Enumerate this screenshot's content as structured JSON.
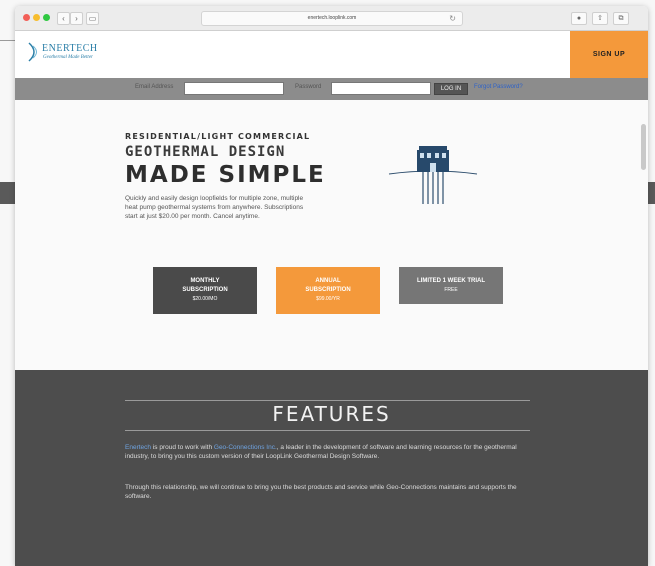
{
  "browser": {
    "url": "enertech.looplink.com",
    "reload_glyph": "↻",
    "back_glyph": "‹",
    "forward_glyph": "›"
  },
  "header": {
    "logo_name": "ENERTECH",
    "logo_tagline": "Geothermal Made Better",
    "signup_label": "SIGN UP"
  },
  "login_bar": {
    "email_label": "Email Address",
    "password_label": "Password",
    "login_label": "LOG IN",
    "forgot_label": "Forgot Password?"
  },
  "hero": {
    "kicker": "RESIDENTIAL/LIGHT COMMERCIAL",
    "title_line1": "GEOTHERMAL DESIGN",
    "title_line2": "MADE SIMPLE",
    "description": "Quickly and easily design loopfields for multiple zone, multiple heat pump geothermal systems from anywhere. Subscriptions start at just $20.00 per month. Cancel anytime.",
    "icon": "house-with-loopfield-icon"
  },
  "plans": {
    "monthly": {
      "line1": "MONTHLY",
      "line2": "SUBSCRIPTION",
      "price": "$20.00/MO"
    },
    "annual": {
      "line1": "ANNUAL",
      "line2": "SUBSCRIPTION",
      "price": "$99.00/YR"
    },
    "trial": {
      "line1": "LIMITED 1 WEEK TRIAL",
      "price": "FREE"
    }
  },
  "features": {
    "title": "FEATURES",
    "p1_link1": "Enertech",
    "p1_part1": " is proud to work with ",
    "p1_link2": "Geo-Connections Inc.",
    "p1_part2": ", a leader in the development of software and learning resources for the geothermal industry, to bring you this custom version of their LoopLink Geothermal Design Software.",
    "p2": "Through this relationship, we will continue to bring you the best products and service while Geo-Connections maintains and supports the software."
  },
  "colors": {
    "accent_orange": "#f4993b",
    "dark_gray": "#4a4a4a",
    "features_bg": "#4d4d4d",
    "link_blue": "#2f63c7"
  }
}
